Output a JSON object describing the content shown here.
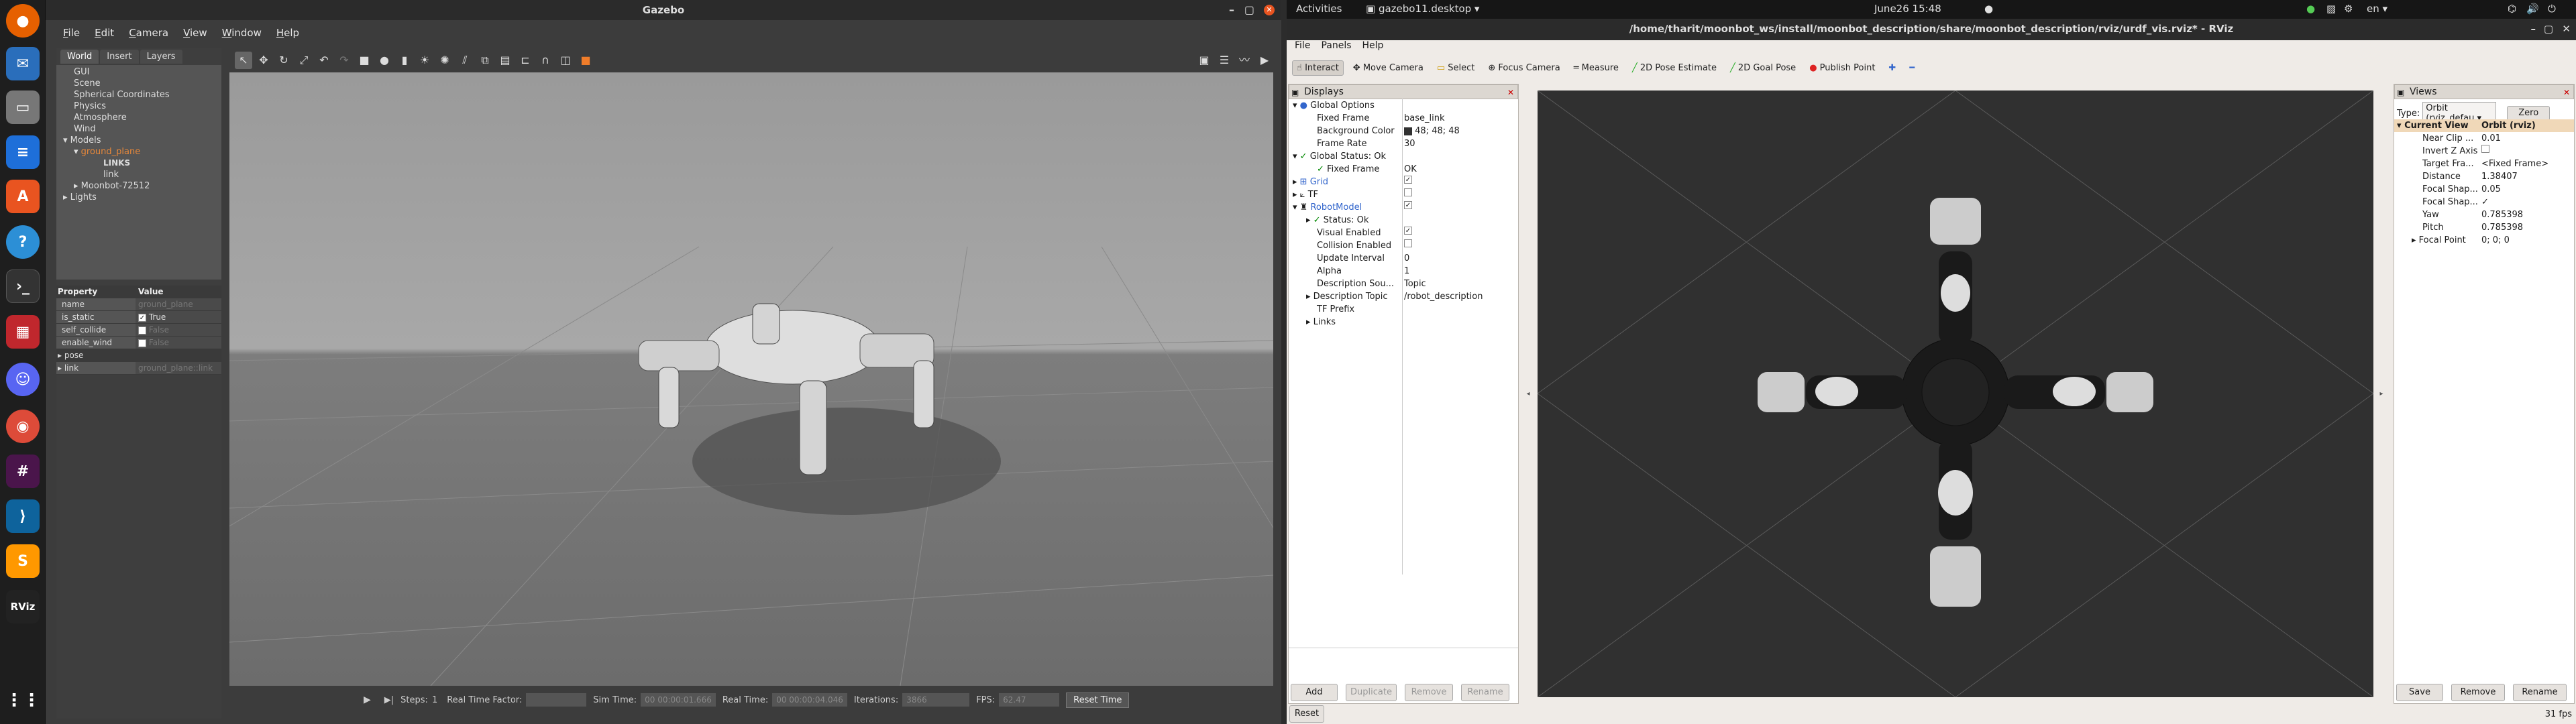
{
  "topbar": {
    "activities": "Activities",
    "app_menu": "gazebo11.desktop",
    "clock": "June26   15:48",
    "lang": "en"
  },
  "dock": {
    "items": [
      "firefox-icon",
      "thunderbird-icon",
      "files-icon",
      "writer-icon",
      "software-icon",
      "help-icon",
      "terminal-icon",
      "screenshot-icon",
      "discord-icon",
      "chrome-icon",
      "slack-icon",
      "vscode-icon",
      "sublime-icon",
      "rviz-icon",
      "apps-grid-icon"
    ],
    "rviz_label": "RViz"
  },
  "gazebo": {
    "title": "Gazebo",
    "menu": [
      "File",
      "Edit",
      "Camera",
      "View",
      "Window",
      "Help"
    ],
    "tabs": [
      "World",
      "Insert",
      "Layers"
    ],
    "tree": {
      "gui": "GUI",
      "scene": "Scene",
      "spherical": "Spherical Coordinates",
      "physics": "Physics",
      "atmosphere": "Atmosphere",
      "wind": "Wind",
      "models": "Models",
      "ground_plane": "ground_plane",
      "links": "LINKS",
      "link": "link",
      "moonbot": "Moonbot-72512",
      "lights": "Lights"
    },
    "props": {
      "h_property": "Property",
      "h_value": "Value",
      "rows": [
        {
          "k": "name",
          "v": "ground_plane"
        },
        {
          "k": "is_static",
          "v": "True"
        },
        {
          "k": "self_collide",
          "v": "False"
        },
        {
          "k": "enable_wind",
          "v": "False"
        },
        {
          "k": "pose",
          "v": ""
        },
        {
          "k": "link",
          "v": "ground_plane::link"
        }
      ]
    },
    "status": {
      "steps_label": "Steps:",
      "steps_value": "1",
      "rtf_label": "Real Time Factor:",
      "rtf_value": "",
      "sim_label": "Sim Time:",
      "sim_value": "00 00:00:01.666",
      "real_label": "Real Time:",
      "real_value": "00 00:00:04.046",
      "iter_label": "Iterations:",
      "iter_value": "3866",
      "fps_label": "FPS:",
      "fps_value": "62.47",
      "reset": "Reset Time"
    }
  },
  "rviz": {
    "title": "/home/tharit/moonbot_ws/install/moonbot_description/share/moonbot_description/rviz/urdf_vis.rviz* - RViz",
    "menu": [
      "File",
      "Panels",
      "Help"
    ],
    "tools": [
      "Interact",
      "Move Camera",
      "Select",
      "Focus Camera",
      "Measure",
      "2D Pose Estimate",
      "2D Goal Pose",
      "Publish Point"
    ],
    "displays_title": "Displays",
    "displays": {
      "global_options": "Global Options",
      "fixed_frame": "Fixed Frame",
      "fixed_frame_v": "base_link",
      "bg_color": "Background Color",
      "bg_color_v": "48; 48; 48",
      "frame_rate": "Frame Rate",
      "frame_rate_v": "30",
      "global_status": "Global Status: Ok",
      "fixed_frame_ok": "Fixed Frame",
      "fixed_frame_ok_v": "OK",
      "grid": "Grid",
      "tf": "TF",
      "robot_model": "RobotModel",
      "status_ok": "Status: Ok",
      "visual_enabled": "Visual Enabled",
      "collision_enabled": "Collision Enabled",
      "update_interval": "Update Interval",
      "update_interval_v": "0",
      "alpha": "Alpha",
      "alpha_v": "1",
      "desc_source": "Description Sou...",
      "desc_source_v": "Topic",
      "desc_topic": "Description Topic",
      "desc_topic_v": "/robot_description",
      "tf_prefix": "TF Prefix",
      "links": "Links"
    },
    "buttons": {
      "add": "Add",
      "duplicate": "Duplicate",
      "remove": "Remove",
      "rename": "Rename",
      "reset": "Reset"
    },
    "views": {
      "title": "Views",
      "type_label": "Type:",
      "type_value": "Orbit (rviz_defau",
      "zero": "Zero",
      "current_view": "Current View",
      "current_view_v": "Orbit (rviz)",
      "rows": [
        {
          "k": "Near Clip ...",
          "v": "0.01"
        },
        {
          "k": "Invert Z Axis",
          "v": ""
        },
        {
          "k": "Target Fra...",
          "v": "<Fixed Frame>"
        },
        {
          "k": "Distance",
          "v": "1.38407"
        },
        {
          "k": "Focal Shap...",
          "v": "0.05"
        },
        {
          "k": "Focal Shap...",
          "v": "✓"
        },
        {
          "k": "Yaw",
          "v": "0.785398"
        },
        {
          "k": "Pitch",
          "v": "0.785398"
        },
        {
          "k": "Focal Point",
          "v": "0; 0; 0"
        }
      ],
      "save": "Save",
      "remove": "Remove",
      "rename": "Rename"
    },
    "fps": "31 fps"
  }
}
